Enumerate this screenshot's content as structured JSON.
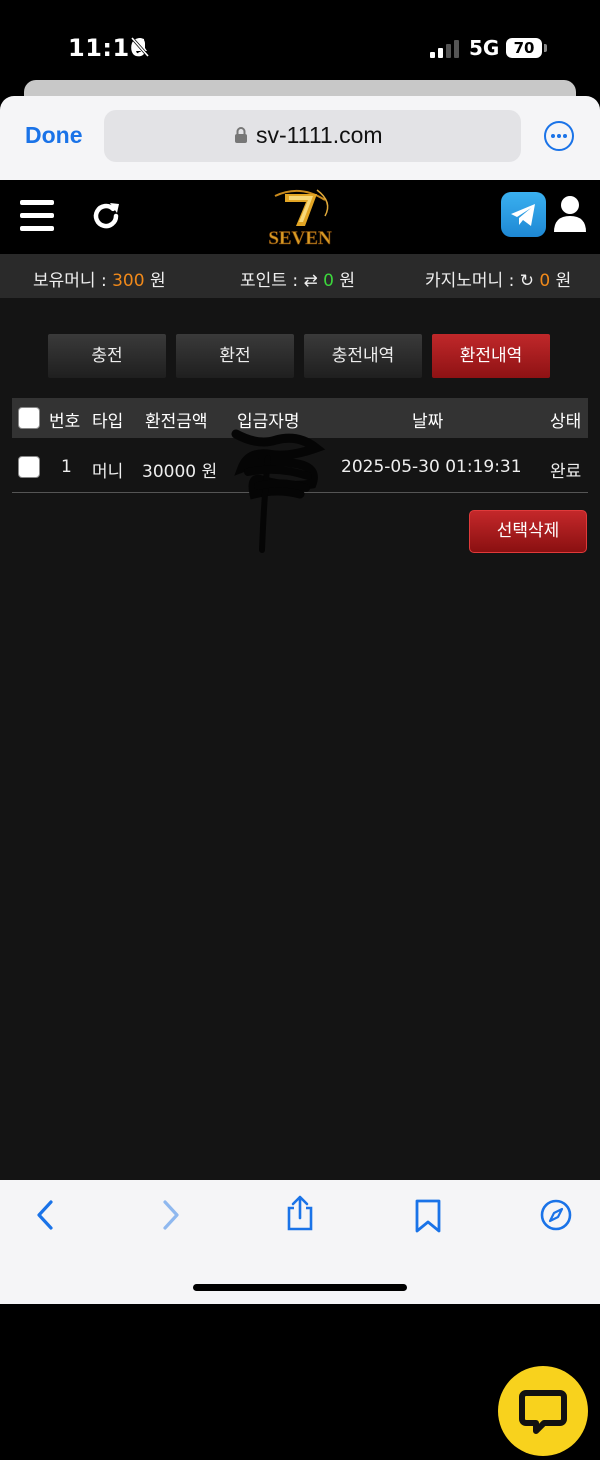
{
  "status_bar": {
    "time": "11:16",
    "network": "5G",
    "battery": "70"
  },
  "browser": {
    "done_label": "Done",
    "url": "sv-1111.com"
  },
  "site": {
    "logo_text": "SEVEN"
  },
  "balance": {
    "money_label": "보유머니 :",
    "money_value": "300",
    "money_unit": "원",
    "point_label": "포인트 :",
    "point_value": "0",
    "point_unit": "원",
    "casino_label": "카지노머니 :",
    "casino_value": "0",
    "casino_unit": "원"
  },
  "tabs": [
    {
      "label": "충전",
      "active": false
    },
    {
      "label": "환전",
      "active": false
    },
    {
      "label": "충전내역",
      "active": false
    },
    {
      "label": "환전내역",
      "active": true
    }
  ],
  "table": {
    "headers": [
      "번호",
      "타입",
      "환전금액",
      "입금자명",
      "날짜",
      "상태"
    ],
    "rows": [
      {
        "no": "1",
        "type": "머니",
        "amount": "30000 원",
        "depositor": "",
        "date": "2025-05-30 01:19:31",
        "status": "완료"
      }
    ]
  },
  "delete_button": "선택삭제",
  "colors": {
    "accent_red": "#a8191b",
    "money_orange": "#f0891a",
    "point_green": "#3cd63c",
    "chat_yellow": "#f8d21d",
    "ios_blue": "#1a73e8"
  }
}
